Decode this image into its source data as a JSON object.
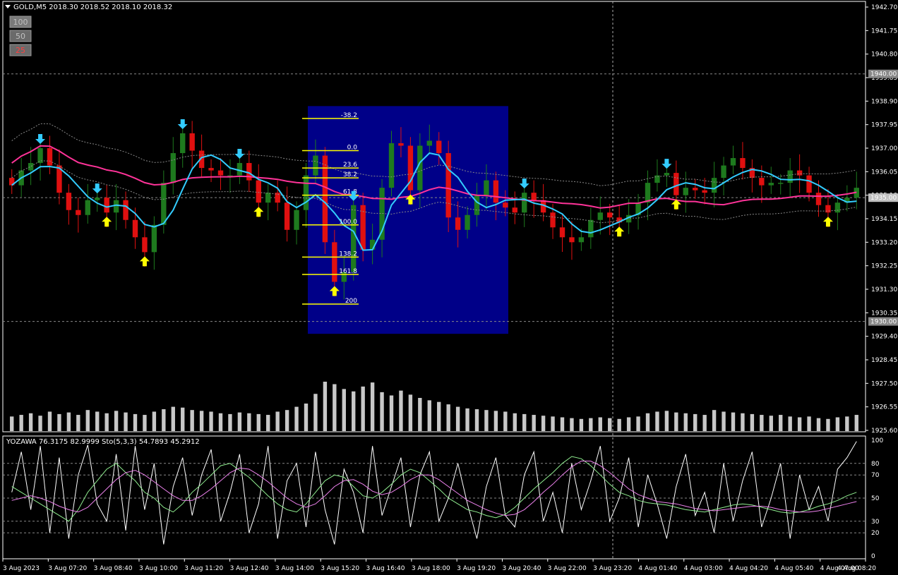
{
  "header": {
    "symbol_line": "GOLD,M5  2018.30 2018.52 2018.10 2018.32",
    "menu_icon": "triangle-down-icon"
  },
  "zoom_buttons": [
    {
      "label": "100",
      "color": "#c0c0c0",
      "bg": "#7a7a7a"
    },
    {
      "label": "50",
      "color": "#c0c0c0",
      "bg": "#6a6a6a"
    },
    {
      "label": "25",
      "color": "#ff4040",
      "bg": "#6a6a6a"
    }
  ],
  "colors": {
    "background": "#000000",
    "bull_bar": "#1e7a1e",
    "bear_bar": "#e01010",
    "ma_slow": "#ff3399",
    "ma_fast": "#33ccff",
    "fib_box": "#000088",
    "fib_line": "#ffff00",
    "arrow_up": "#ffff00",
    "arrow_down": "#33ccff",
    "volume": "#c8c8c8",
    "stoch_main": "#ffffff",
    "stoch_k": "#90ee90",
    "stoch_d": "#ee82ee"
  },
  "chart_data": [
    {
      "type": "candlestick",
      "title": "GOLD,M5",
      "ohlc_header": "2018.30 2018.52 2018.10 2018.32",
      "y_ticks": [
        "1942.70",
        "1941.75",
        "1940.80",
        "1939.85",
        "1938.90",
        "1937.95",
        "1937.00",
        "1936.05",
        "1935.10",
        "1934.15",
        "1933.20",
        "1932.25",
        "1931.30",
        "1930.35",
        "1929.40",
        "1928.45",
        "1927.50",
        "1926.55",
        "1925.60"
      ],
      "ylim": [
        1925.6,
        1942.7
      ],
      "price_labels": [
        {
          "label": "1940.00",
          "value": 1940.0
        },
        {
          "label": "1935.00",
          "value": 1935.0
        },
        {
          "label": "1930.00",
          "value": 1930.0
        }
      ],
      "x_ticks": [
        "3 Aug 2023",
        "3 Aug 07:20",
        "3 Aug 08:40",
        "3 Aug 10:00",
        "3 Aug 11:20",
        "3 Aug 12:40",
        "3 Aug 14:00",
        "3 Aug 15:20",
        "3 Aug 16:40",
        "3 Aug 18:00",
        "3 Aug 19:20",
        "3 Aug 20:40",
        "3 Aug 22:00",
        "3 Aug 23:20",
        "4 Aug 01:40",
        "4 Aug 03:00",
        "4 Aug 04:20",
        "4 Aug 05:40",
        "4 Aug 07:00",
        "4 Aug 08:20"
      ],
      "fibonacci_levels": [
        {
          "label": "-38.2",
          "value": 1938.2
        },
        {
          "label": "0.0",
          "value": 1936.9
        },
        {
          "label": "23.6",
          "value": 1936.2
        },
        {
          "label": "38.2",
          "value": 1935.8
        },
        {
          "label": "61.8",
          "value": 1935.1
        },
        {
          "label": "100.0",
          "value": 1933.9
        },
        {
          "label": "138.2",
          "value": 1932.6
        },
        {
          "label": "161.8",
          "value": 1931.9
        },
        {
          "label": "200",
          "value": 1930.7
        }
      ],
      "fib_box_range": {
        "high": 1938.7,
        "low": 1929.5
      },
      "series": [
        {
          "key": "close",
          "values": [
            1935.5,
            1936.1,
            1936.4,
            1937.0,
            1936.3,
            1935.2,
            1934.5,
            1934.3,
            1934.9,
            1935.0,
            1934.4,
            1934.9,
            1934.1,
            1933.4,
            1932.8,
            1933.9,
            1935.6,
            1936.8,
            1937.6,
            1936.9,
            1936.2,
            1936.1,
            1935.9,
            1935.9,
            1936.4,
            1935.7,
            1934.8,
            1935.2,
            1934.8,
            1933.7,
            1934.5,
            1935.9,
            1936.7,
            1933.2,
            1931.6,
            1932.0,
            1934.7,
            1932.9,
            1933.3,
            1935.4,
            1937.2,
            1937.1,
            1935.3,
            1937.1,
            1937.3,
            1936.8,
            1934.2,
            1933.7,
            1934.3,
            1935.1,
            1935.7,
            1934.8,
            1934.6,
            1934.4,
            1935.2,
            1934.9,
            1934.4,
            1933.8,
            1933.4,
            1933.2,
            1933.4,
            1934.1,
            1934.4,
            1934.2,
            1934.0,
            1934.3,
            1934.8,
            1935.6,
            1935.9,
            1936.0,
            1935.1,
            1935.4,
            1935.3,
            1935.2,
            1935.8,
            1936.3,
            1936.6,
            1936.2,
            1935.8,
            1935.5,
            1935.6,
            1935.6,
            1936.1,
            1935.9,
            1935.2,
            1934.7,
            1934.4,
            1934.8,
            1935.0,
            1935.4
          ]
        }
      ]
    },
    {
      "type": "bar",
      "title": "volume",
      "values": [
        18,
        20,
        22,
        19,
        24,
        21,
        23,
        20,
        26,
        24,
        22,
        25,
        23,
        21,
        20,
        24,
        27,
        30,
        29,
        26,
        25,
        24,
        22,
        21,
        23,
        22,
        21,
        20,
        24,
        26,
        30,
        34,
        46,
        61,
        58,
        52,
        49,
        55,
        60,
        48,
        44,
        50,
        45,
        41,
        38,
        36,
        33,
        30,
        28,
        27,
        26,
        25,
        24,
        22,
        21,
        20,
        19,
        18,
        17,
        16,
        15,
        16,
        17,
        16,
        15,
        17,
        18,
        22,
        24,
        25,
        23,
        22,
        21,
        20,
        26,
        24,
        23,
        22,
        21,
        20,
        19,
        20,
        18,
        17,
        18,
        16,
        15,
        17,
        18,
        20
      ]
    },
    {
      "type": "line",
      "title": "YOZAWA 76.3175 82.9999  Sto(5,3,3) 54.7893 45.2912",
      "y_ticks": [
        "100",
        "80",
        "70",
        "50",
        "30",
        "20",
        "0"
      ],
      "ylim": [
        0,
        100
      ],
      "levels": [
        80,
        70,
        50,
        30,
        20
      ],
      "series": [
        {
          "key": "stoch_main",
          "values": [
            55,
            90,
            40,
            95,
            20,
            85,
            15,
            70,
            96,
            45,
            30,
            88,
            22,
            95,
            40,
            80,
            10,
            60,
            85,
            35,
            70,
            92,
            30,
            55,
            88,
            20,
            45,
            95,
            15,
            65,
            80,
            25,
            90,
            40,
            10,
            75,
            55,
            20,
            95,
            35,
            60,
            85,
            25,
            70,
            90,
            30,
            50,
            80,
            45,
            15,
            60,
            85,
            35,
            25,
            70,
            90,
            30,
            55,
            20,
            80,
            40,
            65,
            95,
            30,
            50,
            85,
            25,
            70,
            45,
            15,
            60,
            88,
            35,
            55,
            20,
            80,
            30,
            65,
            90,
            25,
            50,
            80,
            15,
            70,
            40,
            60,
            30,
            75,
            85,
            99
          ]
        },
        {
          "key": "stoch_k",
          "values": [
            60,
            55,
            50,
            45,
            40,
            35,
            30,
            40,
            55,
            65,
            75,
            80,
            72,
            65,
            55,
            50,
            42,
            38,
            45,
            55,
            62,
            70,
            78,
            80,
            74,
            68,
            60,
            52,
            45,
            40,
            38,
            45,
            55,
            65,
            70,
            68,
            60,
            52,
            50,
            55,
            62,
            70,
            75,
            72,
            65,
            58,
            50,
            45,
            40,
            38,
            35,
            33,
            36,
            42,
            50,
            58,
            65,
            72,
            80,
            86,
            84,
            78,
            70,
            62,
            55,
            52,
            48,
            46,
            45,
            44,
            42,
            40,
            39,
            38,
            40,
            42,
            44,
            45,
            44,
            42,
            40,
            38,
            37,
            38,
            40,
            43,
            45,
            48,
            52,
            55
          ]
        },
        {
          "key": "stoch_d",
          "values": [
            48,
            50,
            52,
            50,
            47,
            43,
            40,
            38,
            42,
            50,
            58,
            66,
            72,
            74,
            70,
            64,
            58,
            52,
            48,
            48,
            52,
            58,
            65,
            72,
            76,
            75,
            70,
            64,
            57,
            50,
            45,
            42,
            45,
            52,
            60,
            65,
            66,
            62,
            56,
            53,
            55,
            60,
            66,
            70,
            70,
            66,
            60,
            54,
            48,
            44,
            40,
            37,
            35,
            36,
            40,
            47,
            55,
            62,
            70,
            77,
            82,
            82,
            78,
            72,
            65,
            58,
            53,
            50,
            47,
            46,
            45,
            43,
            41,
            40,
            39,
            40,
            41,
            42,
            43,
            43,
            42,
            40,
            39,
            38,
            38,
            39,
            41,
            43,
            45,
            47
          ]
        }
      ]
    }
  ]
}
